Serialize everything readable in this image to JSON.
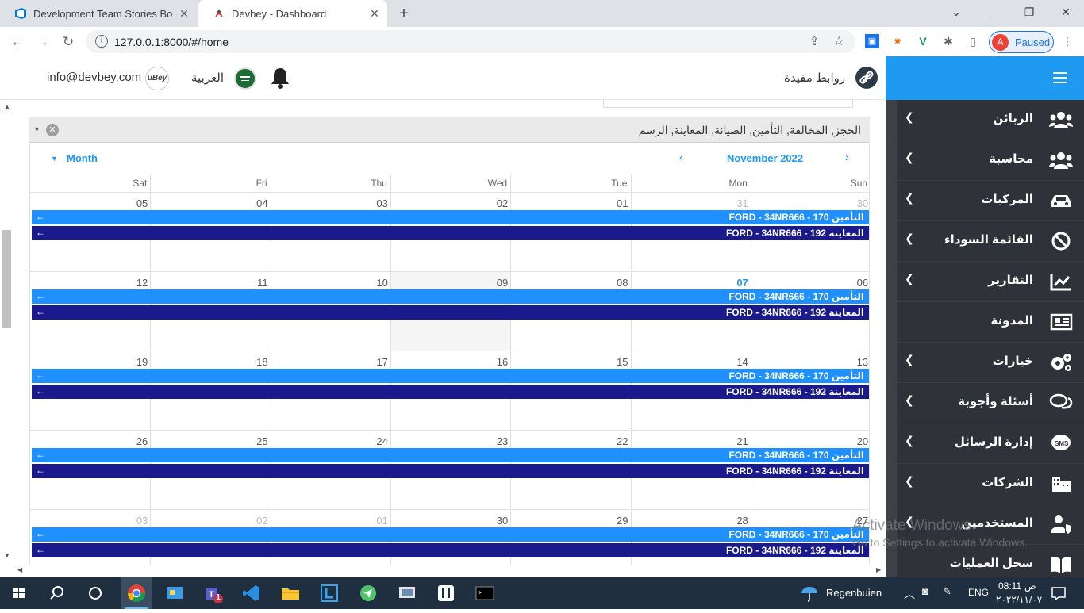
{
  "browser": {
    "tabs": [
      {
        "title": "Development Team Stories Board",
        "active": false
      },
      {
        "title": "Devbey - Dashboard",
        "active": true
      }
    ],
    "new_tab": "+",
    "url": "127.0.0.1:8000/#/home",
    "profile_initial": "A",
    "profile_status": "Paused"
  },
  "header": {
    "email": "info@devbey.com",
    "logo_text": "uBey",
    "language": "العربية",
    "useful_links": "روابط مفيدة"
  },
  "sidebar": {
    "items": [
      {
        "label": "الزبائن",
        "icon": "users-icon",
        "chevron": true
      },
      {
        "label": "محاسبة",
        "icon": "users-icon",
        "chevron": true
      },
      {
        "label": "المركبات",
        "icon": "car-icon",
        "chevron": true
      },
      {
        "label": "القائمة السوداء",
        "icon": "ban-icon",
        "chevron": true
      },
      {
        "label": "التقارير",
        "icon": "chart-icon",
        "chevron": true
      },
      {
        "label": "المدونة",
        "icon": "newspaper-icon",
        "chevron": false
      },
      {
        "label": "خيارات",
        "icon": "gears-icon",
        "chevron": true
      },
      {
        "label": "أسئلة وأجوبة",
        "icon": "chat-icon",
        "chevron": true
      },
      {
        "label": "إدارة الرسائل",
        "icon": "sms-icon",
        "chevron": true
      },
      {
        "label": "الشركات",
        "icon": "building-icon",
        "chevron": true
      },
      {
        "label": "المستخدمين",
        "icon": "user-shield-icon",
        "chevron": true
      },
      {
        "label": "سجل العمليات",
        "icon": "book-icon",
        "chevron": false
      }
    ]
  },
  "panel": {
    "title": "الحجز, المخالفة, التأمين, الصيانة, المعاينة, الرسم"
  },
  "calendar": {
    "view": "Month",
    "month_label": "November 2022",
    "day_names": [
      "Sat",
      "Fri",
      "Thu",
      "Wed",
      "Tue",
      "Mon",
      "Sun"
    ],
    "weeks": [
      {
        "days": [
          {
            "n": "05"
          },
          {
            "n": "04"
          },
          {
            "n": "03"
          },
          {
            "n": "02"
          },
          {
            "n": "01"
          },
          {
            "n": "31",
            "other": true
          },
          {
            "n": "30",
            "other": true
          }
        ]
      },
      {
        "days": [
          {
            "n": "12"
          },
          {
            "n": "11"
          },
          {
            "n": "10"
          },
          {
            "n": "09",
            "today": true
          },
          {
            "n": "08"
          },
          {
            "n": "07",
            "cur": true
          },
          {
            "n": "06"
          }
        ]
      },
      {
        "days": [
          {
            "n": "19"
          },
          {
            "n": "18"
          },
          {
            "n": "17"
          },
          {
            "n": "16"
          },
          {
            "n": "15"
          },
          {
            "n": "14"
          },
          {
            "n": "13"
          }
        ]
      },
      {
        "days": [
          {
            "n": "26"
          },
          {
            "n": "25"
          },
          {
            "n": "24"
          },
          {
            "n": "23"
          },
          {
            "n": "22"
          },
          {
            "n": "21"
          },
          {
            "n": "20"
          }
        ]
      },
      {
        "days": [
          {
            "n": "03",
            "other": true
          },
          {
            "n": "02",
            "other": true
          },
          {
            "n": "01",
            "other": true
          },
          {
            "n": "30"
          },
          {
            "n": "29"
          },
          {
            "n": "28"
          },
          {
            "n": "27"
          }
        ]
      }
    ],
    "events": [
      {
        "text": "التأمين 170 - FORD - 34NR666",
        "type": "insurance",
        "arrow": "←"
      },
      {
        "text": "المعاينة 192 - FORD - 34NR666",
        "type": "inspection",
        "arrow": "←"
      }
    ]
  },
  "watermark": {
    "title": "Activate Windows",
    "subtitle": "Go to Settings to activate Windows."
  },
  "taskbar": {
    "weather": "Regenbuien",
    "lang": "ENG",
    "time": "08:11",
    "ampm": "ص",
    "date": "٢٠٢٢/١١/٠٧",
    "teams_badge": "1"
  }
}
